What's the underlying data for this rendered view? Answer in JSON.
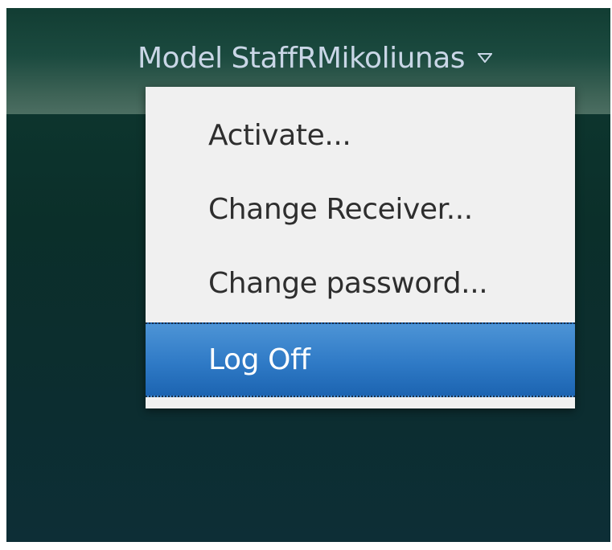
{
  "header": {
    "user_name": "Model StaffRMikoliunas",
    "chevron_icon": "chevron-down-icon",
    "text_color": "#c9d6e6"
  },
  "dropdown_menu": {
    "items": [
      {
        "label": "Activate..."
      },
      {
        "label": "Change Receiver..."
      },
      {
        "label": "Change password..."
      },
      {
        "label": "Log Off",
        "selected": true
      }
    ],
    "highlight_color": "#2f7ac6"
  }
}
